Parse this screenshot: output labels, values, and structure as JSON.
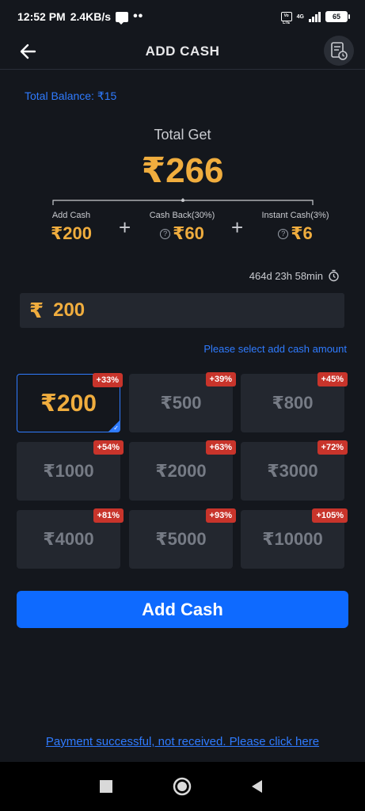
{
  "status_bar": {
    "time": "12:52 PM",
    "speed": "2.4KB/s",
    "dots": "••",
    "volte": "Vo LTE",
    "network": "4G",
    "battery": "65"
  },
  "header": {
    "title": "ADD CASH"
  },
  "balance": {
    "label": "Total Balance: ₹15"
  },
  "summary": {
    "total_get_label": "Total Get",
    "total_get_value": "₹266",
    "add_cash_label": "Add Cash",
    "add_cash_value": "₹200",
    "cash_back_label": "Cash Back(30%)",
    "cash_back_value": "₹60",
    "instant_cash_label": "Instant Cash(3%)",
    "instant_cash_value": "₹6",
    "plus": "+",
    "help_glyph": "?"
  },
  "countdown": {
    "text": "464d 23h 58min"
  },
  "amount_input": {
    "currency": "₹",
    "value": "200"
  },
  "select_hint": "Please select add cash amount",
  "options": [
    {
      "value": "₹200",
      "badge": "+33%",
      "selected": true
    },
    {
      "value": "₹500",
      "badge": "+39%",
      "selected": false
    },
    {
      "value": "₹800",
      "badge": "+45%",
      "selected": false
    },
    {
      "value": "₹1000",
      "badge": "+54%",
      "selected": false
    },
    {
      "value": "₹2000",
      "badge": "+63%",
      "selected": false
    },
    {
      "value": "₹3000",
      "badge": "+72%",
      "selected": false
    },
    {
      "value": "₹4000",
      "badge": "+81%",
      "selected": false
    },
    {
      "value": "₹5000",
      "badge": "+93%",
      "selected": false
    },
    {
      "value": "₹10000",
      "badge": "+105%",
      "selected": false
    }
  ],
  "add_cash_button": "Add Cash",
  "payment_link": "Payment successful, not received. Please click here",
  "colors": {
    "background": "#14171d",
    "accent_gold": "#f0ad3e",
    "accent_blue": "#0e6aff",
    "link_blue": "#2f7bff",
    "badge_red": "#c8342b",
    "tile": "#23272f"
  },
  "icons": {
    "back": "arrow-left-icon",
    "history": "receipt-history-icon",
    "timer": "stopwatch-icon",
    "help": "question-circle-icon",
    "nav_recents": "square-icon",
    "nav_home": "circle-icon",
    "nav_back": "triangle-back-icon"
  }
}
